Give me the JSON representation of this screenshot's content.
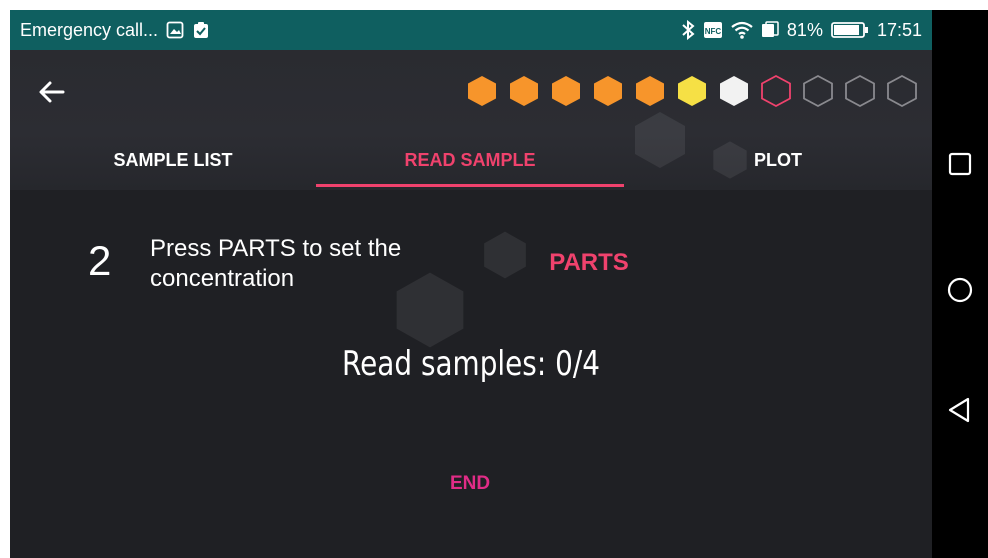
{
  "status_bar": {
    "notification_text": "Emergency call...",
    "battery_percent": "81%",
    "time": "17:51",
    "bg_color": "#0f5f60"
  },
  "header": {
    "back_icon": "arrow-left-icon",
    "progress_hexagons": [
      {
        "state": "filled",
        "color": "#f7952b"
      },
      {
        "state": "filled",
        "color": "#f7952b"
      },
      {
        "state": "filled",
        "color": "#f7952b"
      },
      {
        "state": "filled",
        "color": "#f7952b"
      },
      {
        "state": "filled",
        "color": "#f7952b"
      },
      {
        "state": "filled",
        "color": "#f6e045"
      },
      {
        "state": "filled",
        "color": "#f2f2f2"
      },
      {
        "state": "current",
        "color": "#f0426d"
      },
      {
        "state": "empty",
        "color": "#8a8a8f"
      },
      {
        "state": "empty",
        "color": "#8a8a8f"
      },
      {
        "state": "empty",
        "color": "#8a8a8f"
      }
    ],
    "tabs": [
      {
        "label": "SAMPLE LIST",
        "active": false
      },
      {
        "label": "READ SAMPLE",
        "active": true
      },
      {
        "label": "PLOT",
        "active": false
      }
    ]
  },
  "content": {
    "step_number": "2",
    "instruction": "Press PARTS to set the concentration",
    "parts_button": "PARTS",
    "read_samples": "Read samples: 0/4",
    "end_button": "END"
  },
  "colors": {
    "accent": "#f0426d",
    "end": "#e12c87",
    "background": "#1f2024"
  }
}
